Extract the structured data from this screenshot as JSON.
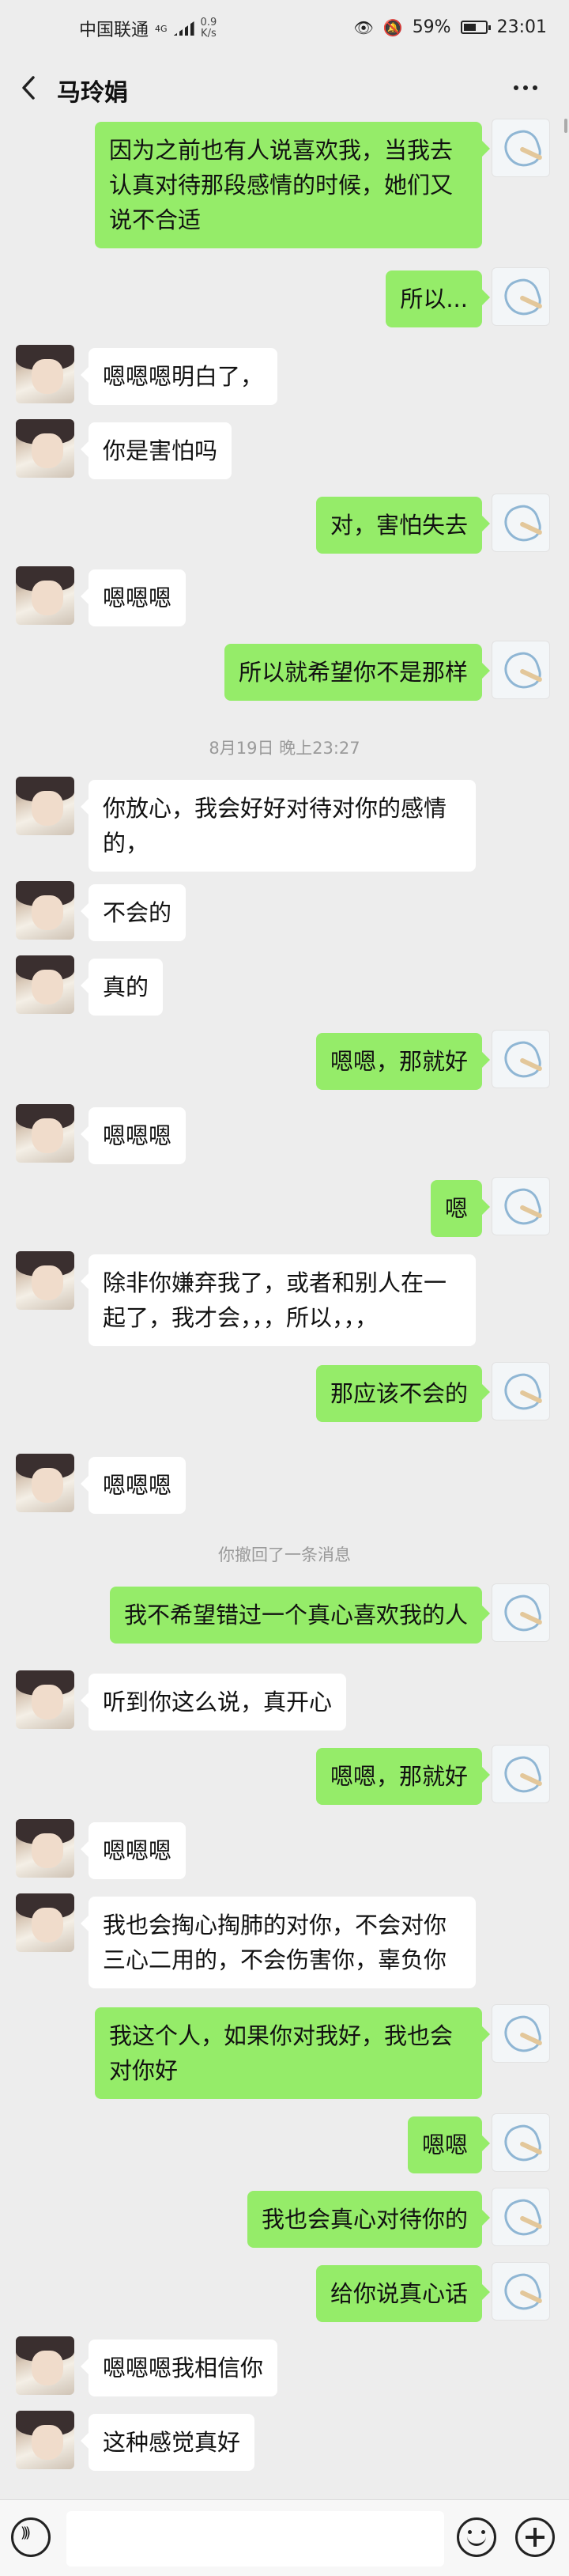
{
  "status": {
    "carrier": "中国联通",
    "network": "4G",
    "speed_value": "0.9",
    "speed_unit": "K/s",
    "battery": "59%",
    "battery_level": 0.59,
    "time": "23:01"
  },
  "header": {
    "title": "马玲娟"
  },
  "messages": [
    {
      "side": "right",
      "text": "因为之前也有人说喜欢我，当我去认真对待那段感情的时候，她们又说不合适"
    },
    {
      "side": "right",
      "text": "所以..."
    },
    {
      "side": "left",
      "text": "嗯嗯嗯明白了，"
    },
    {
      "side": "left",
      "text": "你是害怕吗"
    },
    {
      "side": "right",
      "text": "对，害怕失去"
    },
    {
      "side": "left",
      "text": "嗯嗯嗯"
    },
    {
      "side": "right",
      "text": "所以就希望你不是那样"
    },
    {
      "side": "system",
      "text": "8月19日 晚上23:27"
    },
    {
      "side": "left",
      "text": "你放心，我会好好对待对你的感情的，"
    },
    {
      "side": "left",
      "text": "不会的"
    },
    {
      "side": "left",
      "text": "真的"
    },
    {
      "side": "right",
      "text": "嗯嗯，那就好"
    },
    {
      "side": "left",
      "text": "嗯嗯嗯"
    },
    {
      "side": "right",
      "text": "嗯"
    },
    {
      "side": "left",
      "text": "除非你嫌弃我了，或者和别人在一起了，我才会，，，所以，，，"
    },
    {
      "side": "right",
      "text": "那应该不会的"
    },
    {
      "side": "left",
      "text": "嗯嗯嗯"
    },
    {
      "side": "system",
      "text": "你撤回了一条消息"
    },
    {
      "side": "right",
      "text": "我不希望错过一个真心喜欢我的人"
    },
    {
      "side": "left",
      "text": "听到你这么说，真开心"
    },
    {
      "side": "right",
      "text": "嗯嗯，那就好"
    },
    {
      "side": "left",
      "text": "嗯嗯嗯"
    },
    {
      "side": "left",
      "text": "我也会掏心掏肺的对你，不会对你三心二用的，不会伤害你，辜负你"
    },
    {
      "side": "right",
      "text": "我这个人，如果你对我好，我也会对你好"
    },
    {
      "side": "right",
      "text": "嗯嗯"
    },
    {
      "side": "right",
      "text": "我也会真心对待你的"
    },
    {
      "side": "right",
      "text": "给你说真心话"
    },
    {
      "side": "left",
      "text": "嗯嗯嗯我相信你"
    },
    {
      "side": "left",
      "text": "这种感觉真好"
    }
  ],
  "input": {
    "voice_icon": "voice-icon",
    "emoji_icon": "emoji-icon",
    "plus_icon": "plus-icon"
  },
  "colors": {
    "background": "#ededed",
    "sent_bubble": "#95ec69",
    "received_bubble": "#ffffff"
  }
}
